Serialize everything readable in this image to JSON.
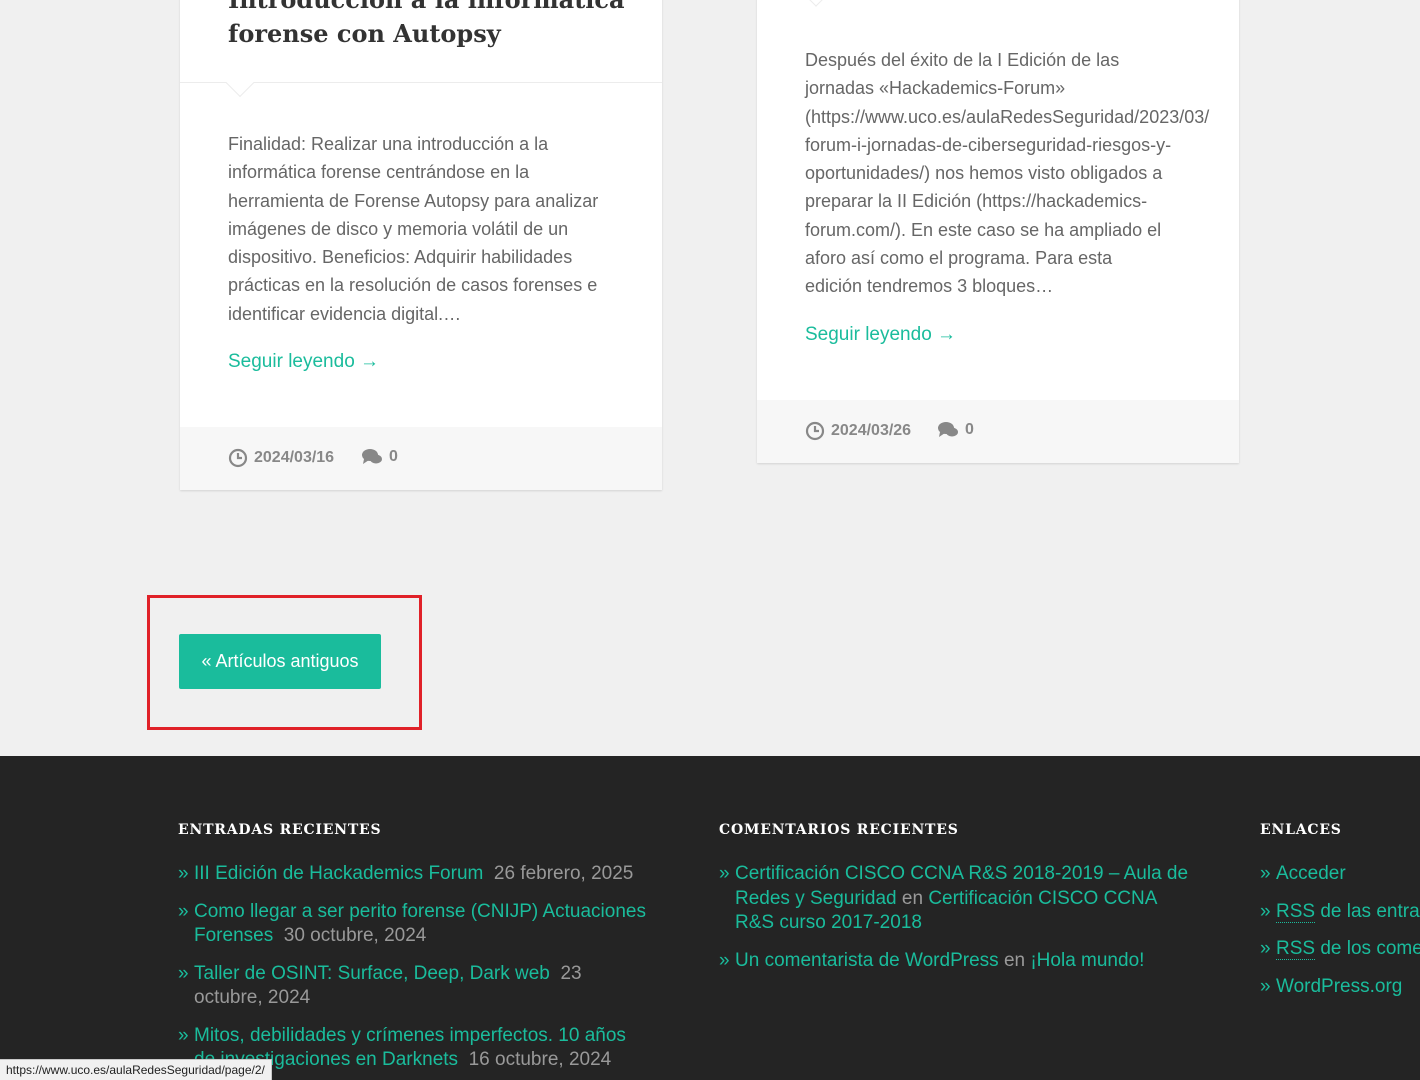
{
  "posts": [
    {
      "title_line1": "Introducción a la informática",
      "title_line2": "forense con Autopsy",
      "excerpt": "Finalidad: Realizar una introducción a la informática forense centrándose en la herramienta de Forense Autopsy para analizar imágenes de disco y memoria volátil de un dispositivo. Beneficios: Adquirir habilidades prácticas en la resolución de casos forenses e identificar evidencia digital.…",
      "read_more": "Seguir leyendo →",
      "date": "2024/03/16",
      "comments": "0"
    },
    {
      "excerpt": "Después del éxito de la I Edición de las\njornadas «Hackademics-Forum»\n(https://www.uco.es/aulaRedesSeguridad/2023/03/\nforum-i-jornadas-de-ciberseguridad-riesgos-y-\noportunidades/) nos hemos visto obligados a\npreparar la II Edición (https://hackademics-\nforum.com/). En este caso se ha ampliado el\naforo así como el programa. Para esta\nedición tendremos 3 bloques…",
      "read_more": "Seguir leyendo →",
      "date": "2024/03/26",
      "comments": "0"
    }
  ],
  "pagination": {
    "older_label": "« Artículos antiguos"
  },
  "footer": {
    "recent_posts": {
      "title": "ENTRADAS RECIENTES",
      "items": [
        {
          "link": "III Edición de Hackademics Forum",
          "date": "26 febrero, 2025"
        },
        {
          "link": "Como llegar a ser perito forense (CNIJP) Actuaciones Forenses",
          "date": "30 octubre, 2024"
        },
        {
          "link": "Taller de OSINT: Surface, Deep, Dark web",
          "date": "23 octubre, 2024"
        },
        {
          "link": "Mitos, debilidades y crímenes imperfectos. 10 años de investigaciones en Darknets",
          "date": "16 octubre, 2024"
        }
      ]
    },
    "recent_comments": {
      "title": "COMENTARIOS RECIENTES",
      "connector": "en",
      "items": [
        {
          "author": "Certificación CISCO CCNA R&S 2018-2019 – Aula de Redes y Seguridad",
          "post": "Certificación CISCO CCNA R&S curso 2017-2018"
        },
        {
          "author": "Un comentarista de WordPress",
          "post": "¡Hola mundo!"
        }
      ]
    },
    "links": {
      "title": "ENLACES",
      "items": [
        {
          "abbr": "",
          "text": "Acceder"
        },
        {
          "abbr": "RSS",
          "text": " de las entradas"
        },
        {
          "abbr": "RSS",
          "text": " de los comentarios"
        },
        {
          "abbr": "",
          "text": "WordPress.org"
        }
      ]
    }
  },
  "status_bar": {
    "url": "https://www.uco.es/aulaRedesSeguridad/page/2/"
  },
  "colors": {
    "accent": "#1abc9c",
    "footer_bg": "#242424",
    "highlight": "#e02128"
  },
  "icons": {
    "date": "clock-icon",
    "comments": "comments-icon"
  }
}
